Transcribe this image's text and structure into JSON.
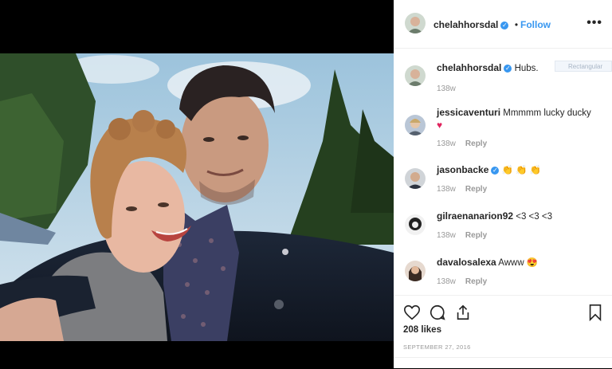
{
  "post": {
    "username": "chelahhorsdal",
    "follow_label": "Follow",
    "more_label": "•••",
    "caption": "Hubs.",
    "caption_time": "138w"
  },
  "ghost_label": "Rectangular",
  "comments": [
    {
      "username": "jessicaventuri",
      "text": "Mmmmm lucky ducky",
      "extra": "♥",
      "time": "138w",
      "reply": "Reply"
    },
    {
      "username": "jasonbacke",
      "text": "👏 👏 👏",
      "time": "138w",
      "reply": "Reply"
    },
    {
      "username": "gilraenanarion92",
      "text": "<3 <3 <3",
      "time": "138w",
      "reply": "Reply"
    },
    {
      "username": "davalosalexa",
      "text": "Awww 😍",
      "time": "138w",
      "reply": "Reply"
    }
  ],
  "footer": {
    "likes": "208 likes",
    "date": "SEPTEMBER 27, 2016"
  },
  "icons": [
    "heart-icon",
    "comment-icon",
    "share-icon",
    "bookmark-icon",
    "verified-icon",
    "more-icon"
  ],
  "colors": {
    "accent": "#3897f0",
    "heart": "#e0245e"
  }
}
